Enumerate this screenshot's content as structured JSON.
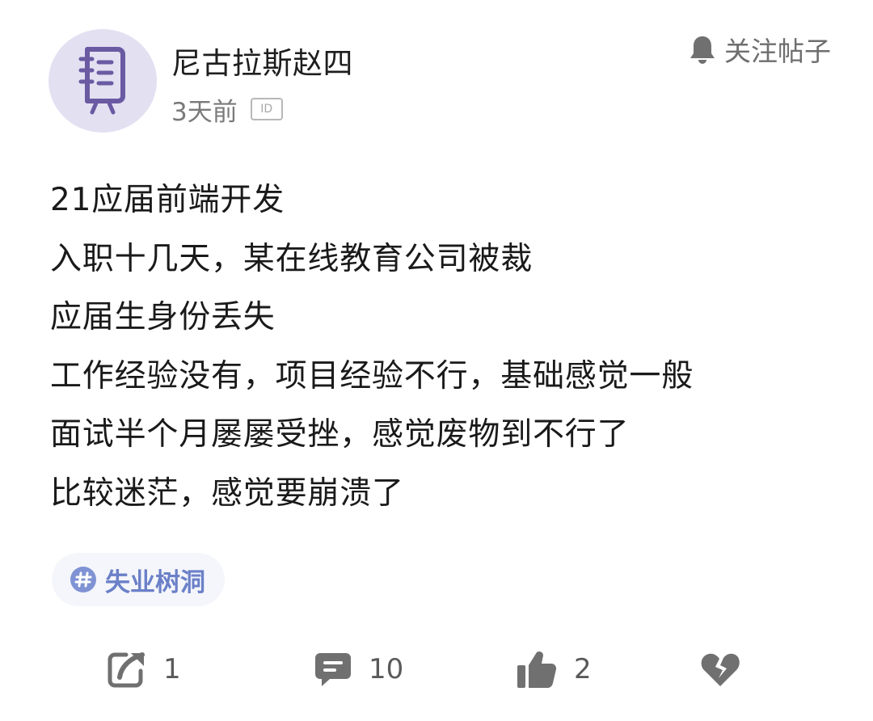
{
  "post": {
    "author": "尼古拉斯赵四",
    "time": "3天前",
    "id_badge": "ID",
    "follow_label": "关注帖子",
    "lines": [
      "21应届前端开发",
      "入职十几天，某在线教育公司被裁",
      "应届生身份丢失",
      "工作经验没有，项目经验不行，基础感觉一般",
      "面试半个月屡屡受挫，感觉废物到不行了",
      "比较迷茫，感觉要崩溃了"
    ],
    "tag": "失业树洞"
  },
  "actions": {
    "share_count": "1",
    "comment_count": "10",
    "like_count": "2"
  },
  "icons": {
    "avatar": "notebook-icon",
    "follow": "bell-icon",
    "tag": "hashtag-icon",
    "share": "share-icon",
    "comment": "comment-icon",
    "like": "thumbs-up-icon",
    "dislike": "broken-heart-icon"
  },
  "colors": {
    "avatar_bg": "#e3e0f2",
    "avatar_icon": "#6a5aa2",
    "tag_text": "#6b80c8",
    "icon_gray": "#707070"
  }
}
